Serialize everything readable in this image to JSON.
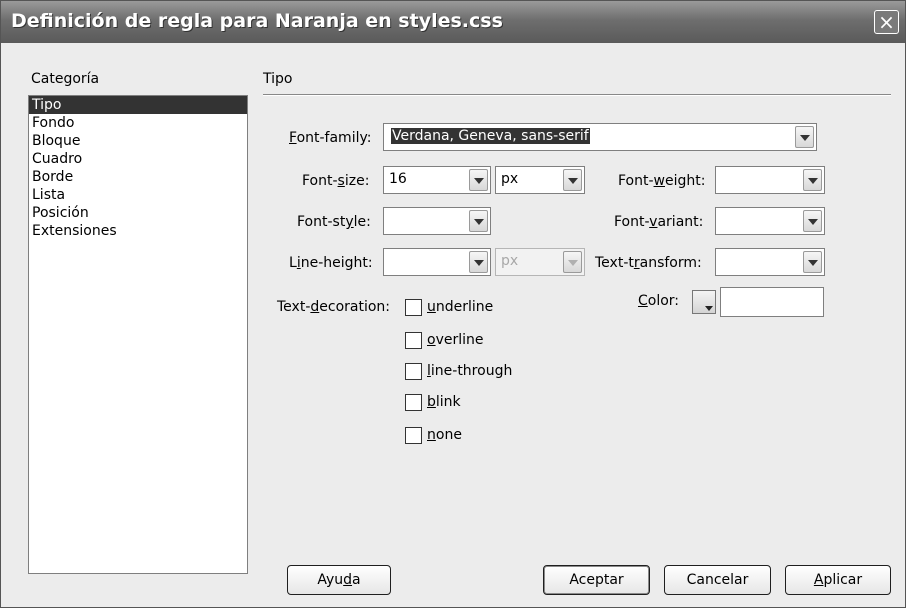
{
  "window": {
    "title": "Definición de regla para Naranja en styles.css",
    "close_icon": "×"
  },
  "sidebar": {
    "heading": "Categoría",
    "items": [
      {
        "label": "Tipo",
        "selected": true
      },
      {
        "label": "Fondo"
      },
      {
        "label": "Bloque"
      },
      {
        "label": "Cuadro"
      },
      {
        "label": "Borde"
      },
      {
        "label": "Lista"
      },
      {
        "label": "Posición"
      },
      {
        "label": "Extensiones"
      }
    ]
  },
  "panel": {
    "title": "Tipo",
    "font_family": {
      "pre": "",
      "key": "F",
      "post": "ont-family:",
      "value": "Verdana, Geneva, sans-serif"
    },
    "font_size": {
      "pre": "Font-",
      "key": "s",
      "post": "ize:",
      "value": "16",
      "unit": "px"
    },
    "font_weight": {
      "pre": "Font-",
      "key": "w",
      "post": "eight:",
      "value": ""
    },
    "font_style": {
      "pre": "Font-st",
      "key": "y",
      "post": "le:",
      "value": ""
    },
    "font_variant": {
      "pre": "Font-",
      "key": "v",
      "post": "ariant:",
      "value": ""
    },
    "line_height": {
      "pre": "L",
      "key": "i",
      "post": "ne-height:",
      "value": "",
      "unit": "px"
    },
    "text_transform": {
      "pre": "Text-t",
      "key": "r",
      "post": "ansform:",
      "value": ""
    },
    "text_decoration": {
      "pre": "Text-",
      "key": "d",
      "post": "ecoration:",
      "options": [
        {
          "key": "u",
          "rest": "nderline",
          "checked": false
        },
        {
          "key": "o",
          "rest": "verline",
          "checked": false
        },
        {
          "key": "l",
          "rest": "ine-through",
          "checked": false
        },
        {
          "key": "b",
          "rest": "link",
          "checked": false
        },
        {
          "key": "n",
          "rest": "one",
          "checked": false
        }
      ]
    },
    "color": {
      "pre": "",
      "key": "C",
      "post": "olor:",
      "value": ""
    }
  },
  "buttons": {
    "help": {
      "pre": "Ayu",
      "key": "d",
      "post": "a"
    },
    "ok": {
      "label": "Aceptar"
    },
    "cancel": {
      "label": "Cancelar"
    },
    "apply": {
      "pre": "",
      "key": "A",
      "post": "plicar"
    }
  }
}
